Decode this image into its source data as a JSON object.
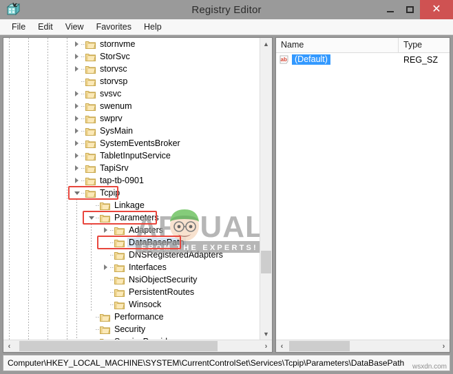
{
  "window": {
    "title": "Registry Editor",
    "app_icon": "registry-editor-icon",
    "controls": {
      "minimize": "minimize-button",
      "maximize": "maximize-button",
      "close": "close-button"
    },
    "close_color": "#cf5252"
  },
  "menu": {
    "items": [
      "File",
      "Edit",
      "View",
      "Favorites",
      "Help"
    ]
  },
  "tree": {
    "nodes": [
      {
        "label": "stornvme",
        "depth": 0,
        "twisty": "collapsed",
        "highlight": false,
        "selected": false
      },
      {
        "label": "StorSvc",
        "depth": 0,
        "twisty": "collapsed",
        "highlight": false,
        "selected": false
      },
      {
        "label": "storvsc",
        "depth": 0,
        "twisty": "collapsed",
        "highlight": false,
        "selected": false
      },
      {
        "label": "storvsp",
        "depth": 0,
        "twisty": "none",
        "highlight": false,
        "selected": false
      },
      {
        "label": "svsvc",
        "depth": 0,
        "twisty": "collapsed",
        "highlight": false,
        "selected": false
      },
      {
        "label": "swenum",
        "depth": 0,
        "twisty": "collapsed",
        "highlight": false,
        "selected": false
      },
      {
        "label": "swprv",
        "depth": 0,
        "twisty": "collapsed",
        "highlight": false,
        "selected": false
      },
      {
        "label": "SysMain",
        "depth": 0,
        "twisty": "collapsed",
        "highlight": false,
        "selected": false
      },
      {
        "label": "SystemEventsBroker",
        "depth": 0,
        "twisty": "collapsed",
        "highlight": false,
        "selected": false
      },
      {
        "label": "TabletInputService",
        "depth": 0,
        "twisty": "collapsed",
        "highlight": false,
        "selected": false
      },
      {
        "label": "TapiSrv",
        "depth": 0,
        "twisty": "collapsed",
        "highlight": false,
        "selected": false
      },
      {
        "label": "tap-tb-0901",
        "depth": 0,
        "twisty": "collapsed",
        "highlight": false,
        "selected": false
      },
      {
        "label": "Tcpip",
        "depth": 0,
        "twisty": "open",
        "highlight": true,
        "selected": false
      },
      {
        "label": "Linkage",
        "depth": 1,
        "twisty": "none",
        "highlight": false,
        "selected": false
      },
      {
        "label": "Parameters",
        "depth": 1,
        "twisty": "open",
        "highlight": true,
        "selected": false
      },
      {
        "label": "Adapters",
        "depth": 2,
        "twisty": "collapsed",
        "highlight": false,
        "selected": false
      },
      {
        "label": "DataBasePath",
        "depth": 2,
        "twisty": "none",
        "highlight": true,
        "selected": true
      },
      {
        "label": "DNSRegisteredAdapters",
        "depth": 2,
        "twisty": "none",
        "highlight": false,
        "selected": false
      },
      {
        "label": "Interfaces",
        "depth": 2,
        "twisty": "collapsed",
        "highlight": false,
        "selected": false
      },
      {
        "label": "NsiObjectSecurity",
        "depth": 2,
        "twisty": "none",
        "highlight": false,
        "selected": false
      },
      {
        "label": "PersistentRoutes",
        "depth": 2,
        "twisty": "none",
        "highlight": false,
        "selected": false
      },
      {
        "label": "Winsock",
        "depth": 2,
        "twisty": "none",
        "highlight": false,
        "selected": false
      },
      {
        "label": "Performance",
        "depth": 1,
        "twisty": "none",
        "highlight": false,
        "selected": false
      },
      {
        "label": "Security",
        "depth": 1,
        "twisty": "none",
        "highlight": false,
        "selected": false
      },
      {
        "label": "ServiceProvider",
        "depth": 1,
        "twisty": "none",
        "highlight": false,
        "selected": false
      }
    ],
    "highlight_color": "#e8453c",
    "selection_color": "#d6e3f0"
  },
  "values_pane": {
    "columns": [
      "Name",
      "Type"
    ],
    "rows": [
      {
        "name": "(Default)",
        "type": "REG_SZ",
        "icon": "string-value-icon",
        "selected": true
      }
    ],
    "selection_color": "#3399ff"
  },
  "statusbar": {
    "path": "Computer\\HKEY_LOCAL_MACHINE\\SYSTEM\\CurrentControlSet\\Services\\Tcpip\\Parameters\\DataBasePath"
  },
  "watermark": {
    "brand": "APPUALS",
    "tagline": "FROM  THE  EXPERTS!",
    "site": "wsxdn.com"
  }
}
